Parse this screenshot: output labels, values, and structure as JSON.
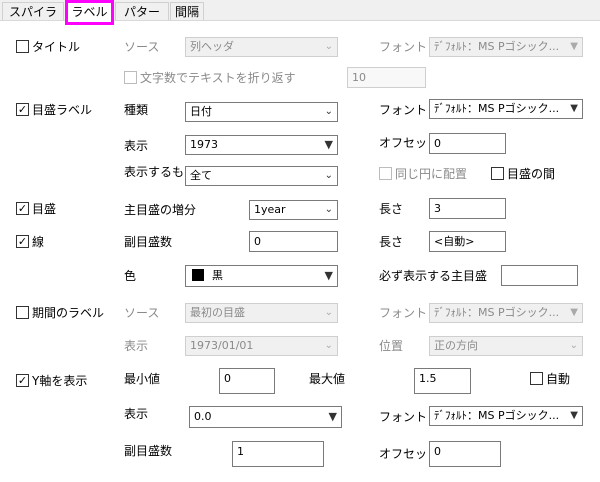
{
  "tabs": [
    {
      "label": "スパイラル"
    },
    {
      "label": "ラベル"
    },
    {
      "label": "パターン"
    },
    {
      "label": "間隔"
    }
  ],
  "colors": {
    "highlight": "#ff00ff",
    "color_swatch": "#000000"
  },
  "title_row": {
    "checkbox_label": "タイトル",
    "checked": false,
    "source_label": "ソース",
    "source_value": "列ヘッダ",
    "font_label": "フォント",
    "font_value": "ﾃﾞﾌｫﾙﾄ：MS Pゴシック...",
    "wrap_label": "文字数でテキストを折り返す",
    "wrap_checked": false,
    "wrap_value": "10"
  },
  "tick_label": {
    "checkbox_label": "目盛ラベル",
    "checked": true,
    "type_label": "種類",
    "type_value": "日付",
    "font_label": "フォント",
    "font_value": "ﾃﾞﾌｫﾙﾄ：MS Pゴシック...",
    "display_label": "表示",
    "display_value": "1973",
    "offset_label": "オフセット",
    "offset_value": "0",
    "show_label": "表示するも",
    "show_value": "全て",
    "same_circle_label": "同じ円に配置",
    "same_circle_checked": false,
    "between_ticks_label": "目盛の間",
    "between_ticks_checked": false
  },
  "ticks": {
    "checkbox_label": "目盛",
    "checked": true,
    "major_inc_label": "主目盛の増分",
    "major_inc_value": "1year",
    "length_label": "長さ",
    "length_value": "3"
  },
  "line": {
    "checkbox_label": "線",
    "checked": true,
    "minor_count_label": "副目盛数",
    "minor_count_value": "0",
    "length_label": "長さ",
    "length_value": "<自動>",
    "color_label": "色",
    "color_value": "黒",
    "required_major_label": "必ず表示する主目盛",
    "required_major_value": ""
  },
  "period_label": {
    "checkbox_label": "期間のラベル",
    "checked": false,
    "source_label": "ソース",
    "source_value": "最初の目盛",
    "font_label": "フォント",
    "font_value": "ﾃﾞﾌｫﾙﾄ：MS Pゴシック...",
    "display_label": "表示",
    "display_value": "1973/01/01",
    "position_label": "位置",
    "position_value": "正の方向"
  },
  "y_axis": {
    "checkbox_label": "Y軸を表示",
    "checked": true,
    "min_label": "最小値",
    "min_value": "0",
    "max_label": "最大値",
    "max_value": "1.5",
    "auto_label": "自動",
    "auto_checked": false,
    "display_label": "表示",
    "display_value": "0.0",
    "font_label": "フォント",
    "font_value": "ﾃﾞﾌｫﾙﾄ：MS Pゴシック...",
    "minor_count_label": "副目盛数",
    "minor_count_value": "1",
    "offset_label": "オフセット",
    "offset_value": "0"
  }
}
